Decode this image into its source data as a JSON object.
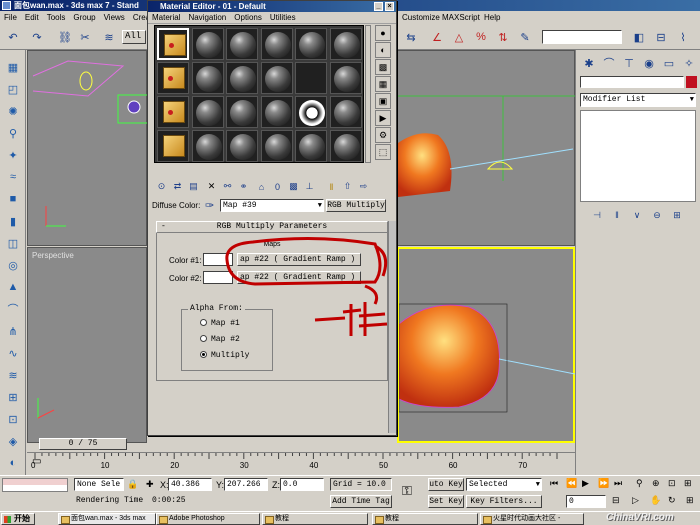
{
  "app": {
    "title": "面包wan.max - 3ds max 7 - Stand",
    "menus": [
      "File",
      "Edit",
      "Tools",
      "Group",
      "Views",
      "Create"
    ],
    "menus_right": [
      "Customize",
      "MAXScript",
      "Help"
    ],
    "selection_filter": "All"
  },
  "viewports": {
    "perspective_label": "Perspective"
  },
  "command_panel": {
    "modifier_list": "Modifier List"
  },
  "material_editor": {
    "title": "Material Editor - 01 - Default",
    "menus": [
      "Material",
      "Navigation",
      "Options",
      "Utilities"
    ],
    "diffuse_label": "Diffuse Color:",
    "map_name": "Map #39",
    "map_type": "RGB Multiply",
    "rollout_title": "RGB Multiply Parameters",
    "maps_label": "Maps",
    "color1_label": "Color #1:",
    "color1_map": "ap #22    ( Gradient Ramp )",
    "color2_label": "Color #2:",
    "color2_map": "ap #22    ( Gradient Ramp )",
    "alpha_group": "Alpha From:",
    "alpha_options": [
      "Map #1",
      "Map #2",
      "Multiply"
    ],
    "alpha_selected": "Multiply",
    "annotation": "一样"
  },
  "timeline": {
    "frame_display": "0 / 75",
    "ruler_ticks": [
      "0",
      "10",
      "20",
      "30",
      "40",
      "50",
      "60",
      "70"
    ]
  },
  "status": {
    "selection": "None Sele",
    "x_label": "X:",
    "x_value": "40.386",
    "y_label": "Y:",
    "y_value": "207.266",
    "z_label": "Z:",
    "z_value": "0.0",
    "grid": "Grid = 10.0",
    "rendering_time_label": "Rendering Time",
    "rendering_time": "0:00:25",
    "add_time_tag": "Add Time Tag",
    "auto_key": "uto Key",
    "set_key": "Set Key",
    "selected": "Selected",
    "key_filters": "Key Filters...",
    "frame": "0"
  },
  "taskbar": {
    "start": "开始",
    "items": [
      "面包wan.max - 3ds max",
      "Adobe Photoshop",
      "教程",
      "教程",
      "火星时代动画大社区 -"
    ]
  },
  "watermark": "ChinaVRI.com",
  "colors": {
    "title_bar": "#0a246a",
    "viewport_bg": "#8a8a8a",
    "active_viewport_border": "#ffff00",
    "annotation_red": "#c00000",
    "bread_orange": "#e87820"
  }
}
